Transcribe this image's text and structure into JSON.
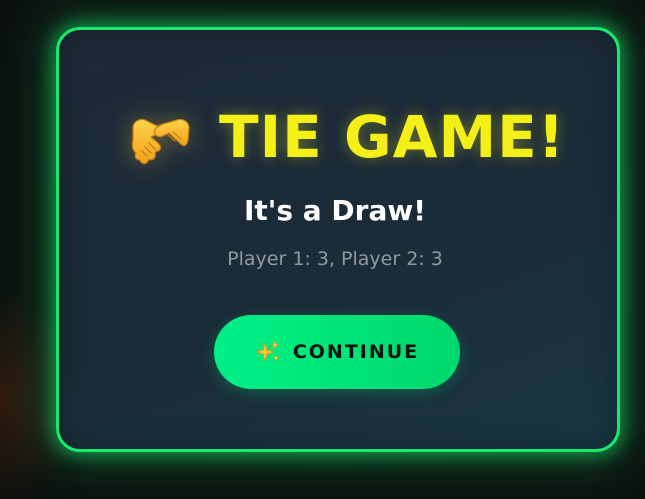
{
  "result_modal": {
    "icon": "handshake-icon",
    "title": "TIE GAME!",
    "subtitle": "It's a Draw!",
    "scores_text": "Player 1: 3, Player 2: 3",
    "continue_button": {
      "icon": "sparkles-icon",
      "label": "CONTINUE"
    }
  },
  "colors": {
    "accent_green": "#19e86f",
    "title_yellow": "#f5ef18",
    "button_green": "#00e47a",
    "panel_bg": "#1b2c38"
  }
}
